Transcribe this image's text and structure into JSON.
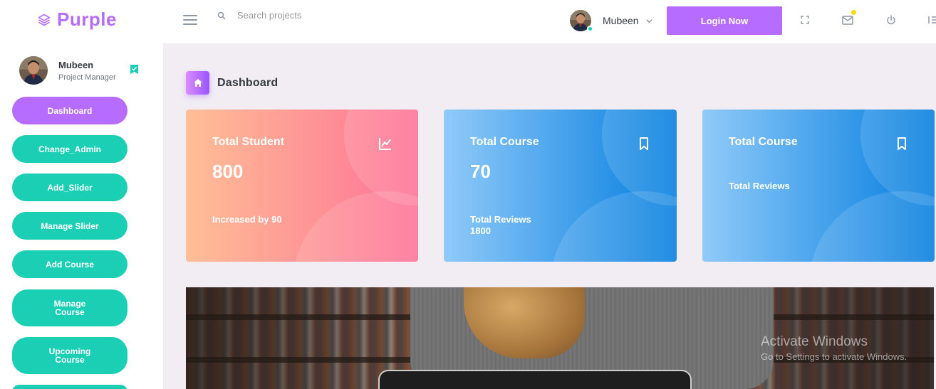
{
  "brand": {
    "name": "Purple",
    "icon": "layers-icon",
    "color": "#b66dff"
  },
  "topbar": {
    "search_placeholder": "Search projects",
    "profile_name": "Mubeen",
    "login_label": "Login Now",
    "icons": [
      "menu-icon",
      "search-icon",
      "chevron-down-icon",
      "fullscreen-icon",
      "mail-icon",
      "power-icon",
      "settings-icon"
    ]
  },
  "sidebar": {
    "profile": {
      "name": "Mubeen",
      "role": "Project Manager"
    },
    "items": [
      {
        "label": "Dashboard",
        "active": true
      },
      {
        "label": "Change_Admin"
      },
      {
        "label": "Add_Slider"
      },
      {
        "label": "Manage Slider"
      },
      {
        "label": "Add Course"
      },
      {
        "label": "Manage\nCourse"
      },
      {
        "label": "Upcoming\nCourse"
      }
    ]
  },
  "page": {
    "title": "Dashboard",
    "icon": "home-icon"
  },
  "cards": [
    {
      "title": "Total Student",
      "value": "800",
      "sub": "Increased by 90",
      "icon": "chart-line-icon"
    },
    {
      "title": "Total Course",
      "value": "70",
      "sub": "Total Reviews\n1800",
      "icon": "bookmark-icon"
    },
    {
      "title": "Total Course",
      "value": "",
      "sub": "Total Reviews",
      "icon": "bookmark-icon"
    }
  ],
  "watermark": {
    "title": "Activate Windows",
    "subtitle": "Go to Settings to activate Windows."
  },
  "colors": {
    "accent": "#b66dff",
    "success": "#1bcfb4",
    "danger_from": "#ffbf96",
    "danger_to": "#fe7096",
    "info_from": "#90caf9",
    "info_to": "#047edf"
  }
}
